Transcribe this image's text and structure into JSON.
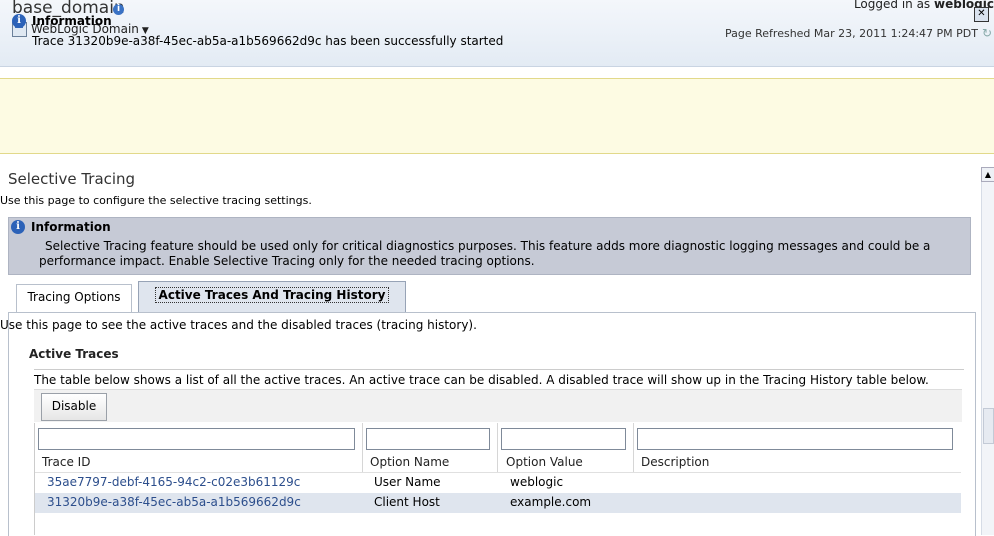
{
  "header": {
    "domain_title": "base_domain",
    "domain_menu_label": "WebLogic Domain",
    "logged_in_prefix": "Logged in as ",
    "logged_in_user": "weblogic",
    "page_refreshed": "Page Refreshed Mar 23, 2011 1:24:47 PM PDT"
  },
  "banner": {
    "title": "Information",
    "message": "Trace 31320b9e-a38f-45ec-ab5a-a1b569662d9c has been successfully started"
  },
  "page": {
    "title": "Selective Tracing",
    "description": "Use this page to configure the selective tracing settings."
  },
  "info": {
    "title": "Information",
    "text": "Selective Tracing feature should be used only for critical diagnostics purposes. This feature adds more diagnostic logging messages and could be a performance impact. Enable Selective Tracing only for the needed tracing options."
  },
  "tabs": [
    {
      "label": "Tracing Options"
    },
    {
      "label": "Active Traces And Tracing History"
    }
  ],
  "panel": {
    "description": "Use this page to see the active traces and the disabled traces (tracing history).",
    "active_title": "Active Traces",
    "active_description": "The table below shows a list of all the active traces. An active trace can be disabled. A disabled trace will show up in the Tracing History table below.",
    "disable_label": "Disable"
  },
  "table": {
    "columns": [
      "Trace ID",
      "Option Name",
      "Option Value",
      "Description"
    ],
    "rows": [
      {
        "trace_id": "35ae7797-debf-4165-94c2-c02e3b61129c",
        "option_name": "User Name",
        "option_value": "weblogic",
        "description": ""
      },
      {
        "trace_id": "31320b9e-a38f-45ec-ab5a-a1b569662d9c",
        "option_name": "Client Host",
        "option_value": "example.com",
        "description": ""
      }
    ]
  },
  "colors": {
    "banner_bg": "#fdfbe3",
    "info_bg": "#c6cad6",
    "link": "#2c4e8c",
    "selected_row": "#dfe5ee"
  }
}
